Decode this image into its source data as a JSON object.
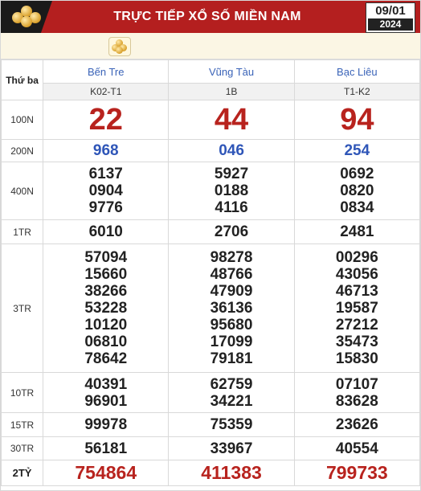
{
  "header": {
    "title": "TRỰC TIẾP XỔ SỐ MIỀN NAM",
    "date_day": "09/01",
    "date_year": "2024",
    "logo_icon": "lottery-balls-icon",
    "accent_color": "#b41f1f"
  },
  "toolbar": {
    "icon": "lottery-balls-icon"
  },
  "table": {
    "day_label": "Thứ ba",
    "provinces": [
      "Bến Tre",
      "Vũng Tàu",
      "Bạc Liêu"
    ],
    "codes": [
      "K02-T1",
      "1B",
      "T1-K2"
    ],
    "prizes": [
      {
        "label": "100N",
        "values": [
          [
            "22"
          ],
          [
            "44"
          ],
          [
            "94"
          ]
        ]
      },
      {
        "label": "200N",
        "values": [
          [
            "968"
          ],
          [
            "046"
          ],
          [
            "254"
          ]
        ]
      },
      {
        "label": "400N",
        "values": [
          [
            "6137",
            "0904",
            "9776"
          ],
          [
            "5927",
            "0188",
            "4116"
          ],
          [
            "0692",
            "0820",
            "0834"
          ]
        ]
      },
      {
        "label": "1TR",
        "values": [
          [
            "6010"
          ],
          [
            "2706"
          ],
          [
            "2481"
          ]
        ]
      },
      {
        "label": "3TR",
        "values": [
          [
            "57094",
            "15660",
            "38266",
            "53228",
            "10120",
            "06810",
            "78642"
          ],
          [
            "98278",
            "48766",
            "47909",
            "36136",
            "95680",
            "17099",
            "79181"
          ],
          [
            "00296",
            "43056",
            "46713",
            "19587",
            "27212",
            "35473",
            "15830"
          ]
        ]
      },
      {
        "label": "10TR",
        "values": [
          [
            "40391",
            "96901"
          ],
          [
            "62759",
            "34221"
          ],
          [
            "07107",
            "83628"
          ]
        ]
      },
      {
        "label": "15TR",
        "values": [
          [
            "99978"
          ],
          [
            "75359"
          ],
          [
            "23626"
          ]
        ]
      },
      {
        "label": "30TR",
        "values": [
          [
            "56181"
          ],
          [
            "33967"
          ],
          [
            "40554"
          ]
        ]
      },
      {
        "label": "2TỶ",
        "values": [
          [
            "754864"
          ],
          [
            "411383"
          ],
          [
            "799733"
          ]
        ]
      }
    ]
  }
}
